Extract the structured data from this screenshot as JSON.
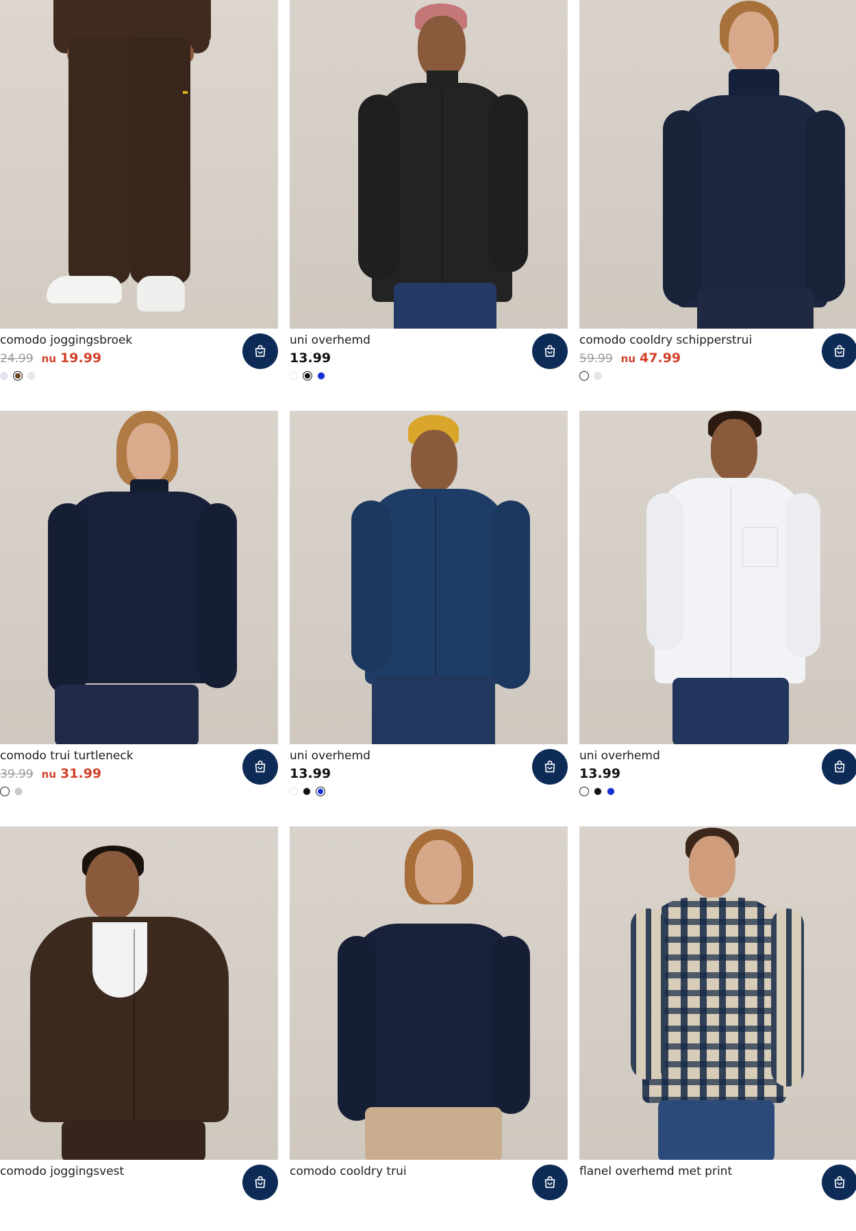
{
  "products": [
    {
      "name": "comodo joggingsbroek",
      "old_price": "24.99",
      "now_label": "nu",
      "price": "19.99",
      "sale": true,
      "swatches": [
        "#e3e6ee",
        "#6b4423",
        "#e8e8e8"
      ],
      "selected": 1
    },
    {
      "name": "uni overhemd",
      "price": "13.99",
      "sale": false,
      "swatches": [
        "#ffffff",
        "#111111",
        "#1530d8"
      ],
      "selected": 1
    },
    {
      "name": "comodo cooldry schipperstrui",
      "old_price": "59.99",
      "now_label": "nu",
      "price": "47.99",
      "sale": true,
      "swatches": [
        "#ffffff",
        "#e6e6e6"
      ],
      "selected": 0
    },
    {
      "name": "comodo trui turtleneck",
      "old_price": "39.99",
      "now_label": "nu",
      "price": "31.99",
      "sale": true,
      "swatches": [
        "#ffffff",
        "#c8c8c8"
      ],
      "selected": 0
    },
    {
      "name": "uni overhemd",
      "price": "13.99",
      "sale": false,
      "swatches": [
        "#ffffff",
        "#111111",
        "#1530d8"
      ],
      "selected": 2
    },
    {
      "name": "uni overhemd",
      "price": "13.99",
      "sale": false,
      "swatches": [
        "#ffffff",
        "#111111",
        "#1530d8"
      ],
      "selected": 0
    },
    {
      "name": "comodo joggingsvest"
    },
    {
      "name": "comodo cooldry trui"
    },
    {
      "name": "flanel overhemd met print"
    }
  ],
  "cart_icon": "shopping-bag-icon",
  "colors": {
    "cart_button": "#0e2b57",
    "sale_red": "#d1412a"
  }
}
